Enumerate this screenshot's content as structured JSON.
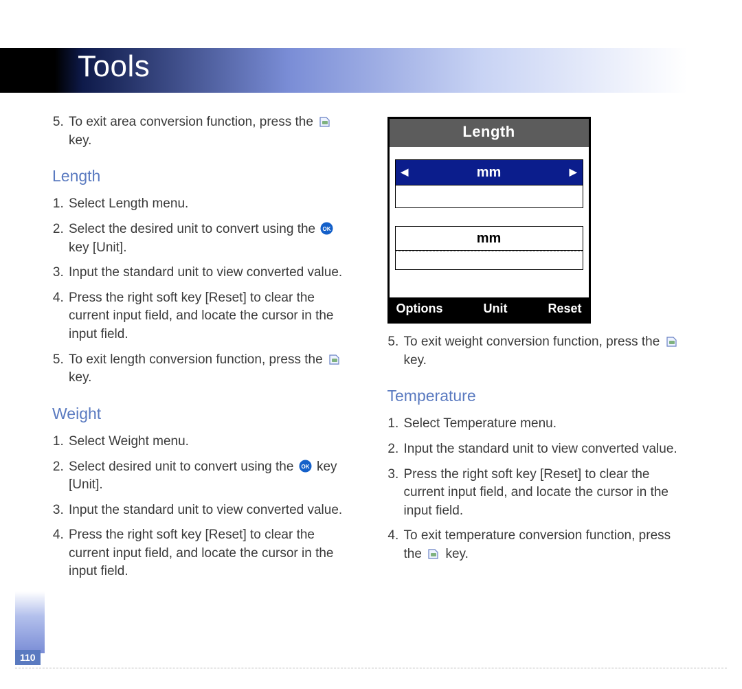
{
  "header": {
    "title": "Tools"
  },
  "left": {
    "top_continuation": {
      "start": 5,
      "items": [
        {
          "pre": "To exit area conversion function, press the ",
          "key": "back",
          "post": " key."
        }
      ]
    },
    "length": {
      "heading": "Length",
      "items": [
        {
          "pre": "Select Length menu."
        },
        {
          "pre": "Select the desired unit to convert using the ",
          "key": "ok",
          "post": " key [Unit]."
        },
        {
          "pre": "Input the standard unit to view converted value."
        },
        {
          "pre": "Press the right soft key [Reset] to clear the current input field, and locate the cursor in the input field."
        },
        {
          "pre": "To exit length conversion function, press the ",
          "key": "back",
          "post": " key."
        }
      ]
    },
    "weight": {
      "heading": "Weight",
      "items": [
        {
          "pre": "Select Weight menu."
        },
        {
          "pre": "Select desired unit to convert using the ",
          "key": "ok",
          "post": " key [Unit]."
        },
        {
          "pre": "Input the standard unit to view converted value."
        },
        {
          "pre": "Press the right soft key [Reset] to clear the current input field, and locate the cursor in the input field."
        }
      ]
    }
  },
  "right": {
    "phone": {
      "title": "Length",
      "unit_selected": "mm",
      "unit_secondary": "mm",
      "softkeys": {
        "left": "Options",
        "center": "Unit",
        "right": "Reset"
      }
    },
    "weight_continuation": {
      "start": 5,
      "items": [
        {
          "pre": "To exit weight conversion function, press the ",
          "key": "back",
          "post": " key."
        }
      ]
    },
    "temperature": {
      "heading": "Temperature",
      "items": [
        {
          "pre": "Select Temperature menu."
        },
        {
          "pre": "Input the standard unit to view converted value."
        },
        {
          "pre": "Press the right soft key [Reset] to clear the current input field, and locate the cursor in the input field."
        },
        {
          "pre": "To exit temperature conversion function, press  the ",
          "key": "back",
          "post": " key."
        }
      ]
    }
  },
  "footer": {
    "page_number": "110"
  }
}
